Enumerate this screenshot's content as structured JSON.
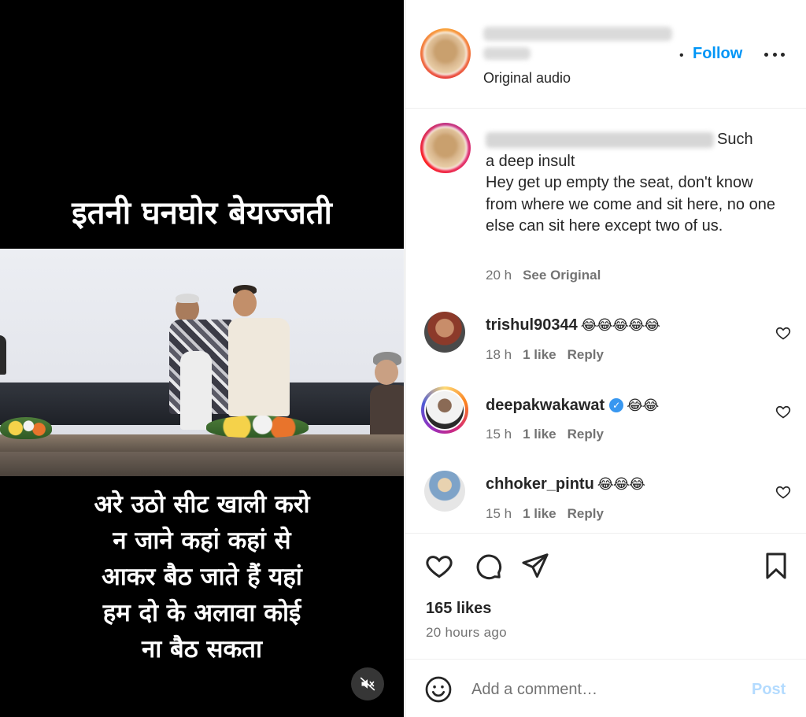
{
  "video": {
    "top_caption": "इतनी घनघोर  बेयज्जती",
    "bottom_caption_lines": [
      "अरे उठो सीट खाली करो",
      "न जाने कहां कहां से",
      "आकर बैठ जाते हैं यहां",
      "हम दो के अलावा कोई",
      "ना बैठ सकता"
    ],
    "mute_icon": "speaker-muted-icon"
  },
  "post": {
    "header": {
      "follow_label": "Follow",
      "dot": "•",
      "audio_label": "Original audio",
      "more_icon": "more-options-icon"
    },
    "caption": {
      "text_first": "Such",
      "text_rest": "a deep insult\nHey get up empty the seat, don't know from where we come and sit here, no one else can sit here except two of us.",
      "time": "20 h",
      "see_original": "See Original"
    },
    "comments": [
      {
        "username": "trishul90344",
        "emoji": "😂😂😂😂😂",
        "verified": false,
        "time": "18 h",
        "likes": "1 like",
        "reply": "Reply"
      },
      {
        "username": "deepakwakawat",
        "emoji": "😂😂",
        "verified": true,
        "time": "15 h",
        "likes": "1 like",
        "reply": "Reply"
      },
      {
        "username": "chhoker_pintu",
        "emoji": "😂😂😂",
        "verified": false,
        "time": "15 h",
        "likes": "1 like",
        "reply": "Reply"
      }
    ],
    "actions": {
      "like_icon": "heart-icon",
      "comment_icon": "comment-icon",
      "share_icon": "share-icon",
      "save_icon": "bookmark-icon"
    },
    "likes_text": "165 likes",
    "posted_text": "20 hours ago",
    "comment_bar": {
      "placeholder": "Add a comment…",
      "post_label": "Post",
      "emoji_icon": "smiley-icon"
    }
  },
  "colors": {
    "accent": "#0095f6",
    "post_disabled": "#b3dbff",
    "muted_text": "#737373",
    "primary_text": "#262626"
  }
}
